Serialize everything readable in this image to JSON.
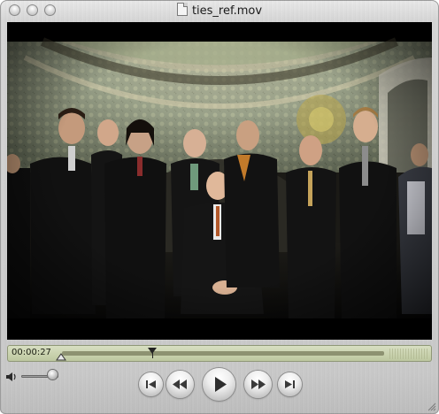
{
  "window": {
    "title": "ties_ref.mov"
  },
  "scrubber": {
    "timecode": "00:00:27",
    "playhead_fraction": 0.28
  },
  "volume": {
    "level_fraction": 0.85
  },
  "icons": {
    "window_controls": [
      "close-icon",
      "minimize-icon",
      "zoom-icon"
    ],
    "title": "movie-document-icon",
    "transport": [
      "go-to-start-icon",
      "rewind-icon",
      "play-icon",
      "fast-forward-icon",
      "go-to-end-icon"
    ],
    "volume": "speaker-icon",
    "resize": "resize-grip-icon"
  },
  "colors": {
    "scrubber_bg": "#c9d2ae",
    "video_bg": "#000000",
    "metal": "#d0d0d0"
  }
}
